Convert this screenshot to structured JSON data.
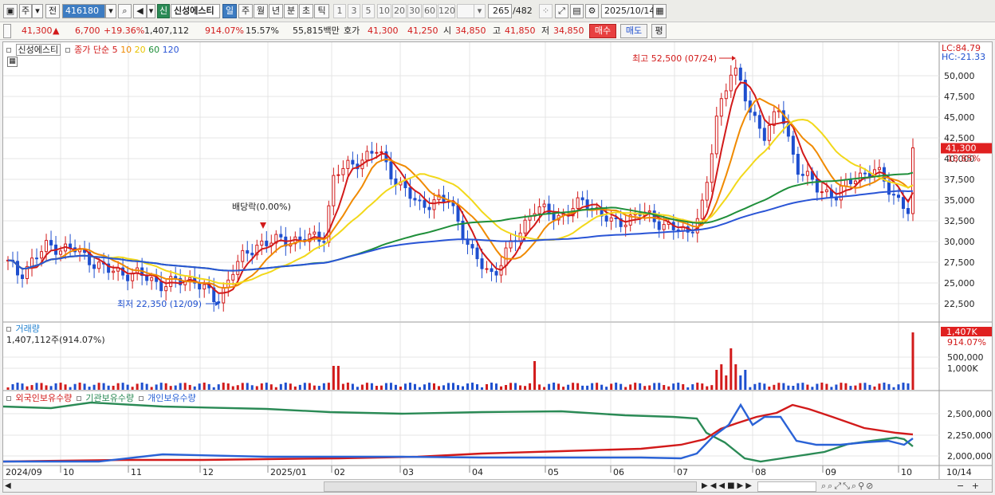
{
  "toolbar": {
    "market": "주",
    "prefix": "전",
    "code": "416180",
    "badge": "신",
    "name": "신성에스티",
    "periods": [
      "일",
      "주",
      "월",
      "년",
      "분",
      "초",
      "틱"
    ],
    "active_period": "일",
    "intervals": [
      "1",
      "3",
      "5",
      "10",
      "20",
      "30",
      "60",
      "120"
    ],
    "count": "265",
    "total": "/482",
    "date": "2025/10/14"
  },
  "quote": {
    "price": "41,300",
    "arrow": "▲",
    "change": "6,700",
    "change_pct": "+19.36%",
    "volume": "1,407,112",
    "volume_pct": "914.07%",
    "turnover": "15.57%",
    "amount": "55,815백만",
    "ask_label": "호가",
    "ask": "41,300",
    "bid": "41,250",
    "open_label": "시",
    "open": "34,850",
    "high_label": "고",
    "high": "41,850",
    "low_label": "저",
    "low": "34,850",
    "buy_label": "매수",
    "sell_label": "매도",
    "eval_label": "평"
  },
  "price_panel": {
    "stock_label": "신성에스티",
    "ma_label": "종가 단순",
    "ma_periods": [
      "5",
      "10",
      "20",
      "60",
      "120"
    ],
    "lc": "LC:84.79",
    "hc": "HC:-21.33",
    "current_price": "41,300",
    "current_pct": "18.85%",
    "high_note": "최고 52,500 (07/24)",
    "low_note": "최저 22,350 (12/09)",
    "dividend_note": "배당락(0.00%)",
    "y_ticks": [
      "50,000",
      "47,500",
      "45,000",
      "42,500",
      "40,000",
      "37,500",
      "35,000",
      "32,500",
      "30,000",
      "27,500",
      "25,000",
      "22,500"
    ]
  },
  "volume_panel": {
    "title": "거래량",
    "value": "1,407,112주(914.07%)",
    "current": "1,407K",
    "pct": "914.07%",
    "y_ticks": [
      "1,000K",
      "500,000"
    ]
  },
  "holdings_panel": {
    "series": [
      "외국인보유수량",
      "기관보유수량",
      "개인보유수량"
    ],
    "y_ticks": [
      "2,500,000",
      "2,250,000",
      "2,000,000"
    ]
  },
  "x_axis": [
    "2024/09",
    "10",
    "11",
    "12",
    "2025/01",
    "02",
    "03",
    "04",
    "05",
    "06",
    "07",
    "08",
    "09",
    "10",
    "10/14"
  ],
  "colors": {
    "up": "#d21a1a",
    "down": "#1e4fcf",
    "ma5": "#d21a1a",
    "ma10": "#f08a00",
    "ma20": "#f2d81a",
    "ma60": "#1f8f3a",
    "ma120": "#2a55d6",
    "foreign": "#d21a1a",
    "institution": "#2a8a55",
    "individual": "#2a62d6"
  }
}
